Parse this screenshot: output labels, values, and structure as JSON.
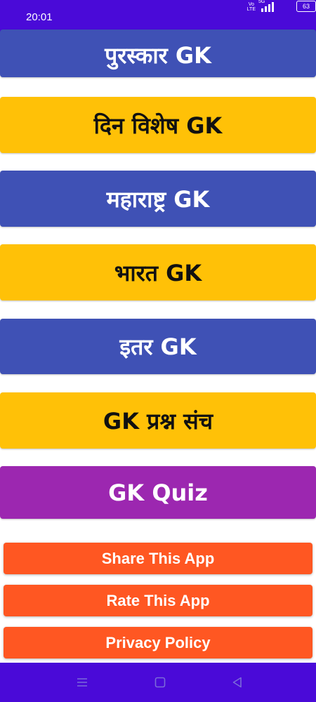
{
  "status_bar": {
    "time": "20:01",
    "volte": "Vo\nLTE",
    "network": "5G",
    "battery": "63",
    "icons": [
      "volte-icon",
      "signal-icon",
      "battery-icon"
    ]
  },
  "menu": {
    "items": [
      {
        "label": "पुरस्कार GK",
        "color": "#3f51b5"
      },
      {
        "label": "दिन विशेष GK",
        "color": "#ffc107"
      },
      {
        "label": "महाराष्ट्र GK",
        "color": "#3f51b5"
      },
      {
        "label": "भारत GK",
        "color": "#ffc107"
      },
      {
        "label": "इतर GK",
        "color": "#3f51b5"
      },
      {
        "label": "GK प्रश्न संच",
        "color": "#ffc107"
      },
      {
        "label": "GK Quiz",
        "color": "#9c27b0"
      }
    ]
  },
  "actions": {
    "share": "Share This App",
    "rate": "Rate This App",
    "privacy": "Privacy Policy",
    "color": "#ff5722"
  },
  "nav_bar": {
    "icons": [
      "menu-icon",
      "home-icon",
      "back-icon"
    ],
    "color": "#4a0ad8"
  }
}
